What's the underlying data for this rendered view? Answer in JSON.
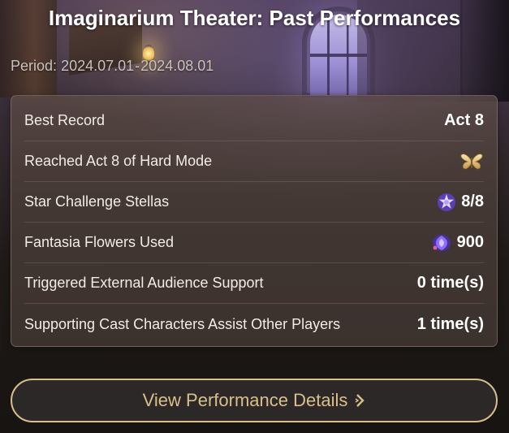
{
  "header": {
    "title": "Imaginarium Theater: Past Performances"
  },
  "period": {
    "label": "Period:",
    "start": "2024.07.01",
    "separator": "-",
    "end": "2024.08.01"
  },
  "stats": [
    {
      "label": "Best Record",
      "value": "Act 8",
      "icon": ""
    },
    {
      "label": "Reached Act 8 of Hard Mode",
      "value": "",
      "icon": "butterfly-medal-icon"
    },
    {
      "label": "Star Challenge Stellas",
      "value": "8/8",
      "icon": "stella-star-icon"
    },
    {
      "label": "Fantasia Flowers Used",
      "value": "900",
      "icon": "fantasia-flower-icon"
    },
    {
      "label": "Triggered External Audience Support",
      "value": "0 time(s)",
      "icon": ""
    },
    {
      "label": "Supporting Cast Characters Assist Other Players",
      "value": "1 time(s)",
      "icon": ""
    }
  ],
  "cta": {
    "label": "View Performance Details",
    "icon": "chevron-right-icon"
  },
  "colors": {
    "accent_gold": "#d9c08a",
    "panel": "#4a3e3a",
    "stella_purple": "#8a6cff",
    "flower_purple": "#7c5cf0"
  }
}
